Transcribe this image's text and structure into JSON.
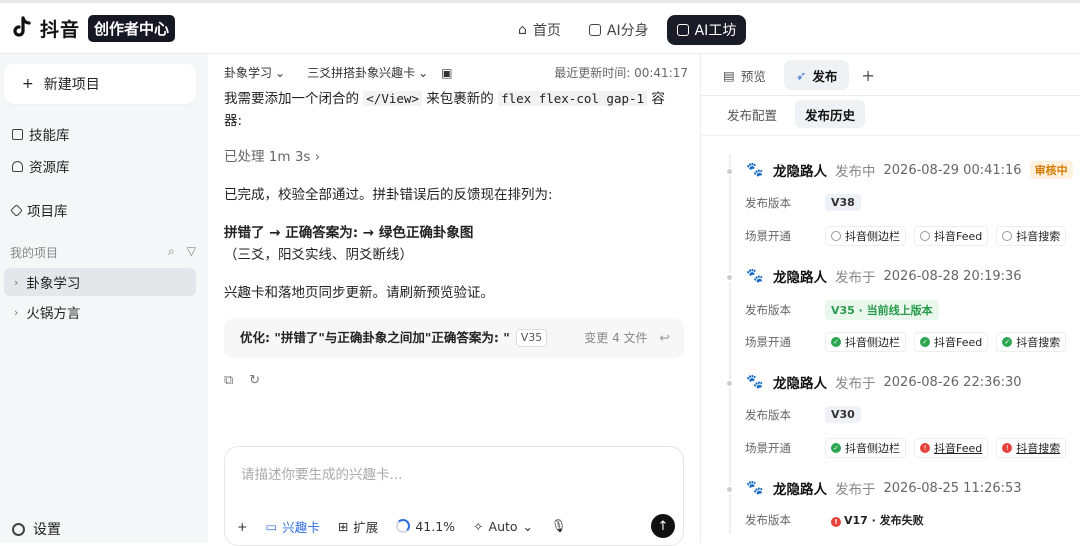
{
  "topbar": {
    "logo_text": "抖音",
    "logo_badge": "创作者中心",
    "nav": [
      {
        "label": "首页",
        "icon": "home-icon",
        "active": false
      },
      {
        "label": "AI分身",
        "icon": "ai-avatar-icon",
        "active": false
      },
      {
        "label": "AI工坊",
        "icon": "workshop-icon",
        "active": true
      }
    ]
  },
  "sidebar": {
    "new_project": "新建项目",
    "links": [
      "技能库",
      "资源库",
      "项目库"
    ],
    "my_projects_label": "我的项目",
    "projects": [
      "卦象学习",
      "火锅方言"
    ],
    "settings": "设置"
  },
  "chat": {
    "crumb1": "卦象学习",
    "crumb2": "三爻拼搭卦象兴趣卡",
    "updated": "最近更新时间: 00:41:17",
    "line1_pre": "我需要添加一个闭合的",
    "line1_code1": "</View>",
    "line1_mid": "来包裹新的",
    "line1_code2": "flex flex-col gap-1",
    "line1_post": "容",
    "line2": "器:",
    "processed": "已处理 1m 3s",
    "done": "已完成，校验全部通过。拼卦错误后的反馈现在排列为:",
    "bold_line": "拼错了 → 正确答案为: → 绿色正确卦象图",
    "paren_line": "（三爻，阳爻实线、阴爻断线）",
    "sync_line": "兴趣卡和落地页同步更新。请刷新预览验证。",
    "change_title": "优化: \"拼错了\"与正确卦象之间加\"正确答案为: \"",
    "change_version": "V35",
    "change_files": "变更 4 文件",
    "composer_placeholder": "请描述你要生成的兴趣卡...",
    "composer": {
      "card": "兴趣卡",
      "expand": "扩展",
      "progress": "41.1%",
      "mode": "Auto"
    }
  },
  "panel": {
    "tabs": [
      {
        "label": "预览",
        "active": false
      },
      {
        "label": "发布",
        "active": true
      }
    ],
    "subtabs": [
      {
        "label": "发布配置",
        "active": false
      },
      {
        "label": "发布历史",
        "active": true
      }
    ],
    "labels": {
      "version": "发布版本",
      "scenes": "场景开通"
    },
    "entries": [
      {
        "user": "龙隐路人",
        "status": "发布中",
        "time": "2026-08-29 00:41:16",
        "badge": "审核中",
        "version": "V38",
        "scenes": [
          {
            "name": "抖音侧边栏",
            "state": "pending"
          },
          {
            "name": "抖音Feed",
            "state": "pending"
          },
          {
            "name": "抖音搜索",
            "state": "pending"
          }
        ]
      },
      {
        "user": "龙隐路人",
        "status": "发布于",
        "time": "2026-08-28 20:19:36",
        "version": "V35 · 当前线上版本",
        "scenes": [
          {
            "name": "抖音侧边栏",
            "state": "ok"
          },
          {
            "name": "抖音Feed",
            "state": "ok"
          },
          {
            "name": "抖音搜索",
            "state": "ok"
          }
        ]
      },
      {
        "user": "龙隐路人",
        "status": "发布于",
        "time": "2026-08-26 22:36:30",
        "version": "V30",
        "scenes": [
          {
            "name": "抖音侧边栏",
            "state": "ok"
          },
          {
            "name": "抖音Feed",
            "state": "fail"
          },
          {
            "name": "抖音搜索",
            "state": "fail"
          }
        ]
      },
      {
        "user": "龙隐路人",
        "status": "发布于",
        "time": "2026-08-25 11:26:53",
        "version": "V17 · 发布失败"
      }
    ]
  }
}
